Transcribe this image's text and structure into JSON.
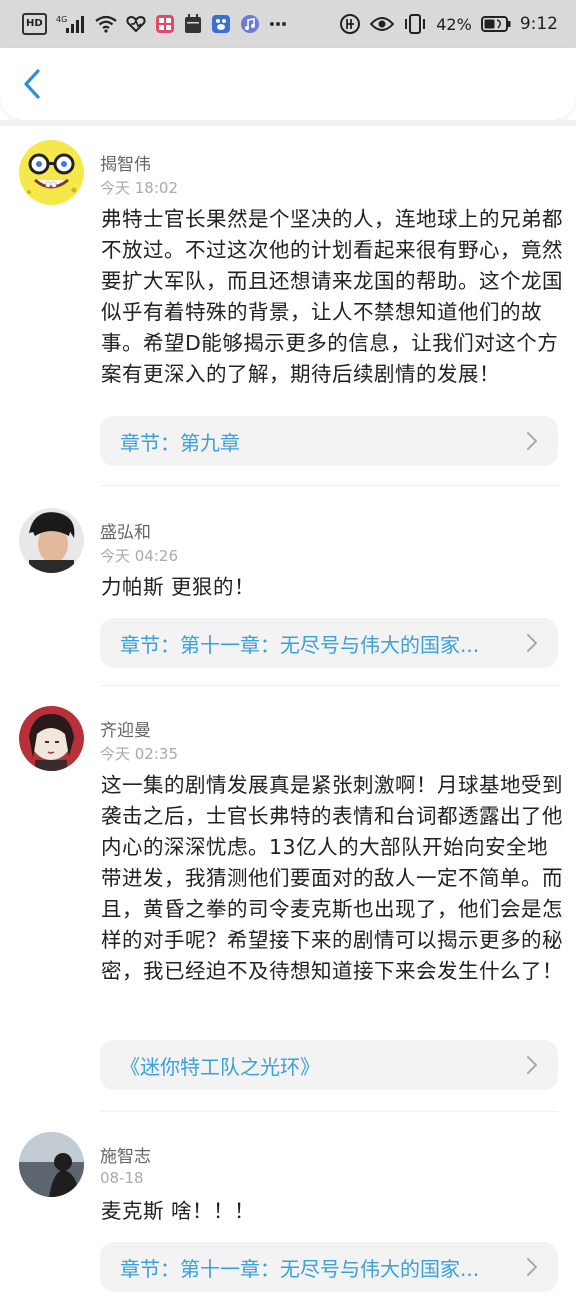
{
  "status_bar": {
    "hd": "HD",
    "network": "4G",
    "battery": "42%",
    "time": "9:12"
  },
  "header": {
    "back_icon": "chevron-left-icon",
    "accent": "#2f8fd8"
  },
  "comments": [
    {
      "user": "揭智伟",
      "time": "今天 18:02",
      "text": "弗特士官长果然是个坚决的人，连地球上的兄弟都不放过。不过这次他的计划看起来很有野心，竟然要扩大军队，而且还想请来龙国的帮助。这个龙国似乎有着特殊的背景，让人不禁想知道他们的故事。希望D能够揭示更多的信息，让我们对这个方案有更深入的了解，期待后续剧情的发展！",
      "link": "章节：第九章"
    },
    {
      "user": "盛弘和",
      "time": "今天 04:26",
      "text": "力帕斯 更狠的！",
      "link": "章节：第十一章：无尽号与伟大的国家..."
    },
    {
      "user": "齐迎曼",
      "time": "今天 02:35",
      "text": "这一集的剧情发展真是紧张刺激啊！月球基地受到袭击之后，士官长弗特的表情和台词都透露出了他内心的深深忧虑。13亿人的大部队开始向安全地带进发，我猜测他们要面对的敌人一定不简单。而且，黄昏之拳的司令麦克斯也出现了，他们会是怎样的对手呢？希望接下来的剧情可以揭示更多的秘密，我已经迫不及待想知道接下来会发生什么了！",
      "link": "《迷你特工队之光环》"
    },
    {
      "user": "施智志",
      "time": "08-18",
      "text": "麦克斯 啥！！！",
      "link": "章节：第十一章：无尽号与伟大的国家..."
    }
  ]
}
